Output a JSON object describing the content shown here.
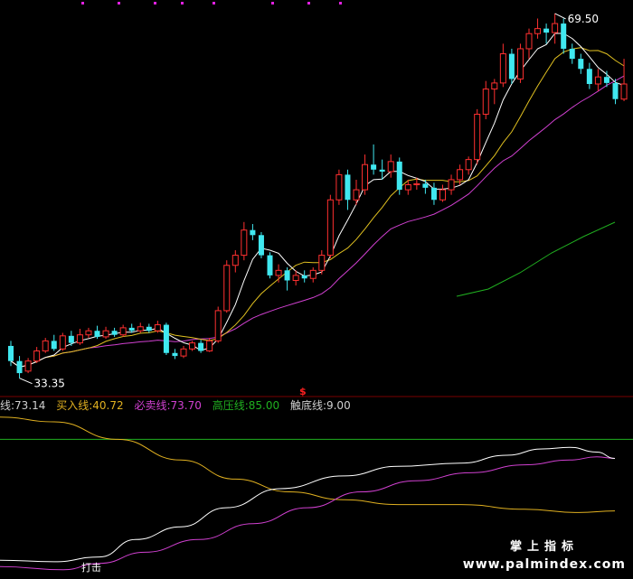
{
  "chart_data": {
    "type": "candlestick",
    "price_annotations": {
      "high": "69.50",
      "low": "33.35"
    },
    "signal_marker": "$",
    "indicator": {
      "lines": [
        {
          "name": "线:",
          "value": "73.14",
          "color": "#cfcfcf"
        },
        {
          "name": "买入线:",
          "value": "40.72",
          "color": "#e0b020"
        },
        {
          "name": "必卖线:",
          "value": "73.70",
          "color": "#d040d0"
        },
        {
          "name": "高压线:",
          "value": "85.00",
          "color": "#20b020"
        },
        {
          "name": "触底线:",
          "value": "9.00",
          "color": "#cfcfcf"
        }
      ],
      "annotation": "打击"
    },
    "candles": [
      [
        36.5,
        35.0,
        37.0,
        34.5
      ],
      [
        35.0,
        33.8,
        35.5,
        33.3
      ],
      [
        34.0,
        35.0,
        35.3,
        33.8
      ],
      [
        35.0,
        36.0,
        36.4,
        34.8
      ],
      [
        36.0,
        37.0,
        37.3,
        35.8
      ],
      [
        37.0,
        36.2,
        37.6,
        36.0
      ],
      [
        36.2,
        37.5,
        37.8,
        36.0
      ],
      [
        37.5,
        36.8,
        38.0,
        36.5
      ],
      [
        36.8,
        37.6,
        38.2,
        36.6
      ],
      [
        37.6,
        38.0,
        38.3,
        37.3
      ],
      [
        38.0,
        37.4,
        38.5,
        37.2
      ],
      [
        37.4,
        38.0,
        38.4,
        37.2
      ],
      [
        38.0,
        37.6,
        38.3,
        37.4
      ],
      [
        37.6,
        38.3,
        38.6,
        37.4
      ],
      [
        38.3,
        38.0,
        38.7,
        37.8
      ],
      [
        38.0,
        38.4,
        38.8,
        37.8
      ],
      [
        38.4,
        38.0,
        38.7,
        37.8
      ],
      [
        38.0,
        38.6,
        39.0,
        37.8
      ],
      [
        38.6,
        35.8,
        38.8,
        35.6
      ],
      [
        35.8,
        35.5,
        36.2,
        35.2
      ],
      [
        35.5,
        36.2,
        36.5,
        35.3
      ],
      [
        36.2,
        36.8,
        37.0,
        36.0
      ],
      [
        36.8,
        36.0,
        37.1,
        35.8
      ],
      [
        36.0,
        37.0,
        37.3,
        35.9
      ],
      [
        37.0,
        40.0,
        40.4,
        36.8
      ],
      [
        40.0,
        44.5,
        45.0,
        39.8
      ],
      [
        44.5,
        45.5,
        46.0,
        43.8
      ],
      [
        45.5,
        48.0,
        48.8,
        45.0
      ],
      [
        48.0,
        47.5,
        48.6,
        47.0
      ],
      [
        47.5,
        45.5,
        47.8,
        45.2
      ],
      [
        45.5,
        43.5,
        45.8,
        43.2
      ],
      [
        43.5,
        44.0,
        44.6,
        42.8
      ],
      [
        44.0,
        43.0,
        44.3,
        42.0
      ],
      [
        43.0,
        43.5,
        44.0,
        42.5
      ],
      [
        43.5,
        43.2,
        44.0,
        42.8
      ],
      [
        43.2,
        44.0,
        44.3,
        42.8
      ],
      [
        44.0,
        45.5,
        46.0,
        43.6
      ],
      [
        45.5,
        51.0,
        51.5,
        45.2
      ],
      [
        51.0,
        53.5,
        54.0,
        50.5
      ],
      [
        53.5,
        51.0,
        54.0,
        50.0
      ],
      [
        51.0,
        52.0,
        53.0,
        50.5
      ],
      [
        52.0,
        54.5,
        55.5,
        51.5
      ],
      [
        54.5,
        54.0,
        56.5,
        53.5
      ],
      [
        54.0,
        53.8,
        55.0,
        53.0
      ],
      [
        53.8,
        54.8,
        55.5,
        53.2
      ],
      [
        54.8,
        52.0,
        55.2,
        51.5
      ],
      [
        52.0,
        52.5,
        53.0,
        51.5
      ],
      [
        52.5,
        52.6,
        53.2,
        52.0
      ],
      [
        52.6,
        52.2,
        53.0,
        51.6
      ],
      [
        52.2,
        51.0,
        52.7,
        50.5
      ],
      [
        51.0,
        52.0,
        52.5,
        50.8
      ],
      [
        52.0,
        53.0,
        53.5,
        51.5
      ],
      [
        53.0,
        54.0,
        54.5,
        52.5
      ],
      [
        54.0,
        55.0,
        55.3,
        53.5
      ],
      [
        55.0,
        59.5,
        60.0,
        54.5
      ],
      [
        59.5,
        62.0,
        62.8,
        59.0
      ],
      [
        62.0,
        62.6,
        63.0,
        60.5
      ],
      [
        62.6,
        65.5,
        66.5,
        62.2
      ],
      [
        65.5,
        63.0,
        66.0,
        62.5
      ],
      [
        63.0,
        66.0,
        66.5,
        62.6
      ],
      [
        66.0,
        67.5,
        68.0,
        65.0
      ],
      [
        67.5,
        68.0,
        69.0,
        67.0
      ],
      [
        68.0,
        67.6,
        68.5,
        66.5
      ],
      [
        67.6,
        68.5,
        69.5,
        66.5
      ],
      [
        68.5,
        66.0,
        69.0,
        65.5
      ],
      [
        66.0,
        65.0,
        66.5,
        64.5
      ],
      [
        65.0,
        64.0,
        65.5,
        63.5
      ],
      [
        64.0,
        62.5,
        64.6,
        62.0
      ],
      [
        62.5,
        63.2,
        64.0,
        61.8
      ],
      [
        63.2,
        62.6,
        63.8,
        62.2
      ],
      [
        62.6,
        61.0,
        63.0,
        60.5
      ],
      [
        61.0,
        62.5,
        65.0,
        60.8
      ]
    ]
  },
  "watermark": {
    "cn": "掌上指标",
    "url": "www.palmindex.com"
  }
}
